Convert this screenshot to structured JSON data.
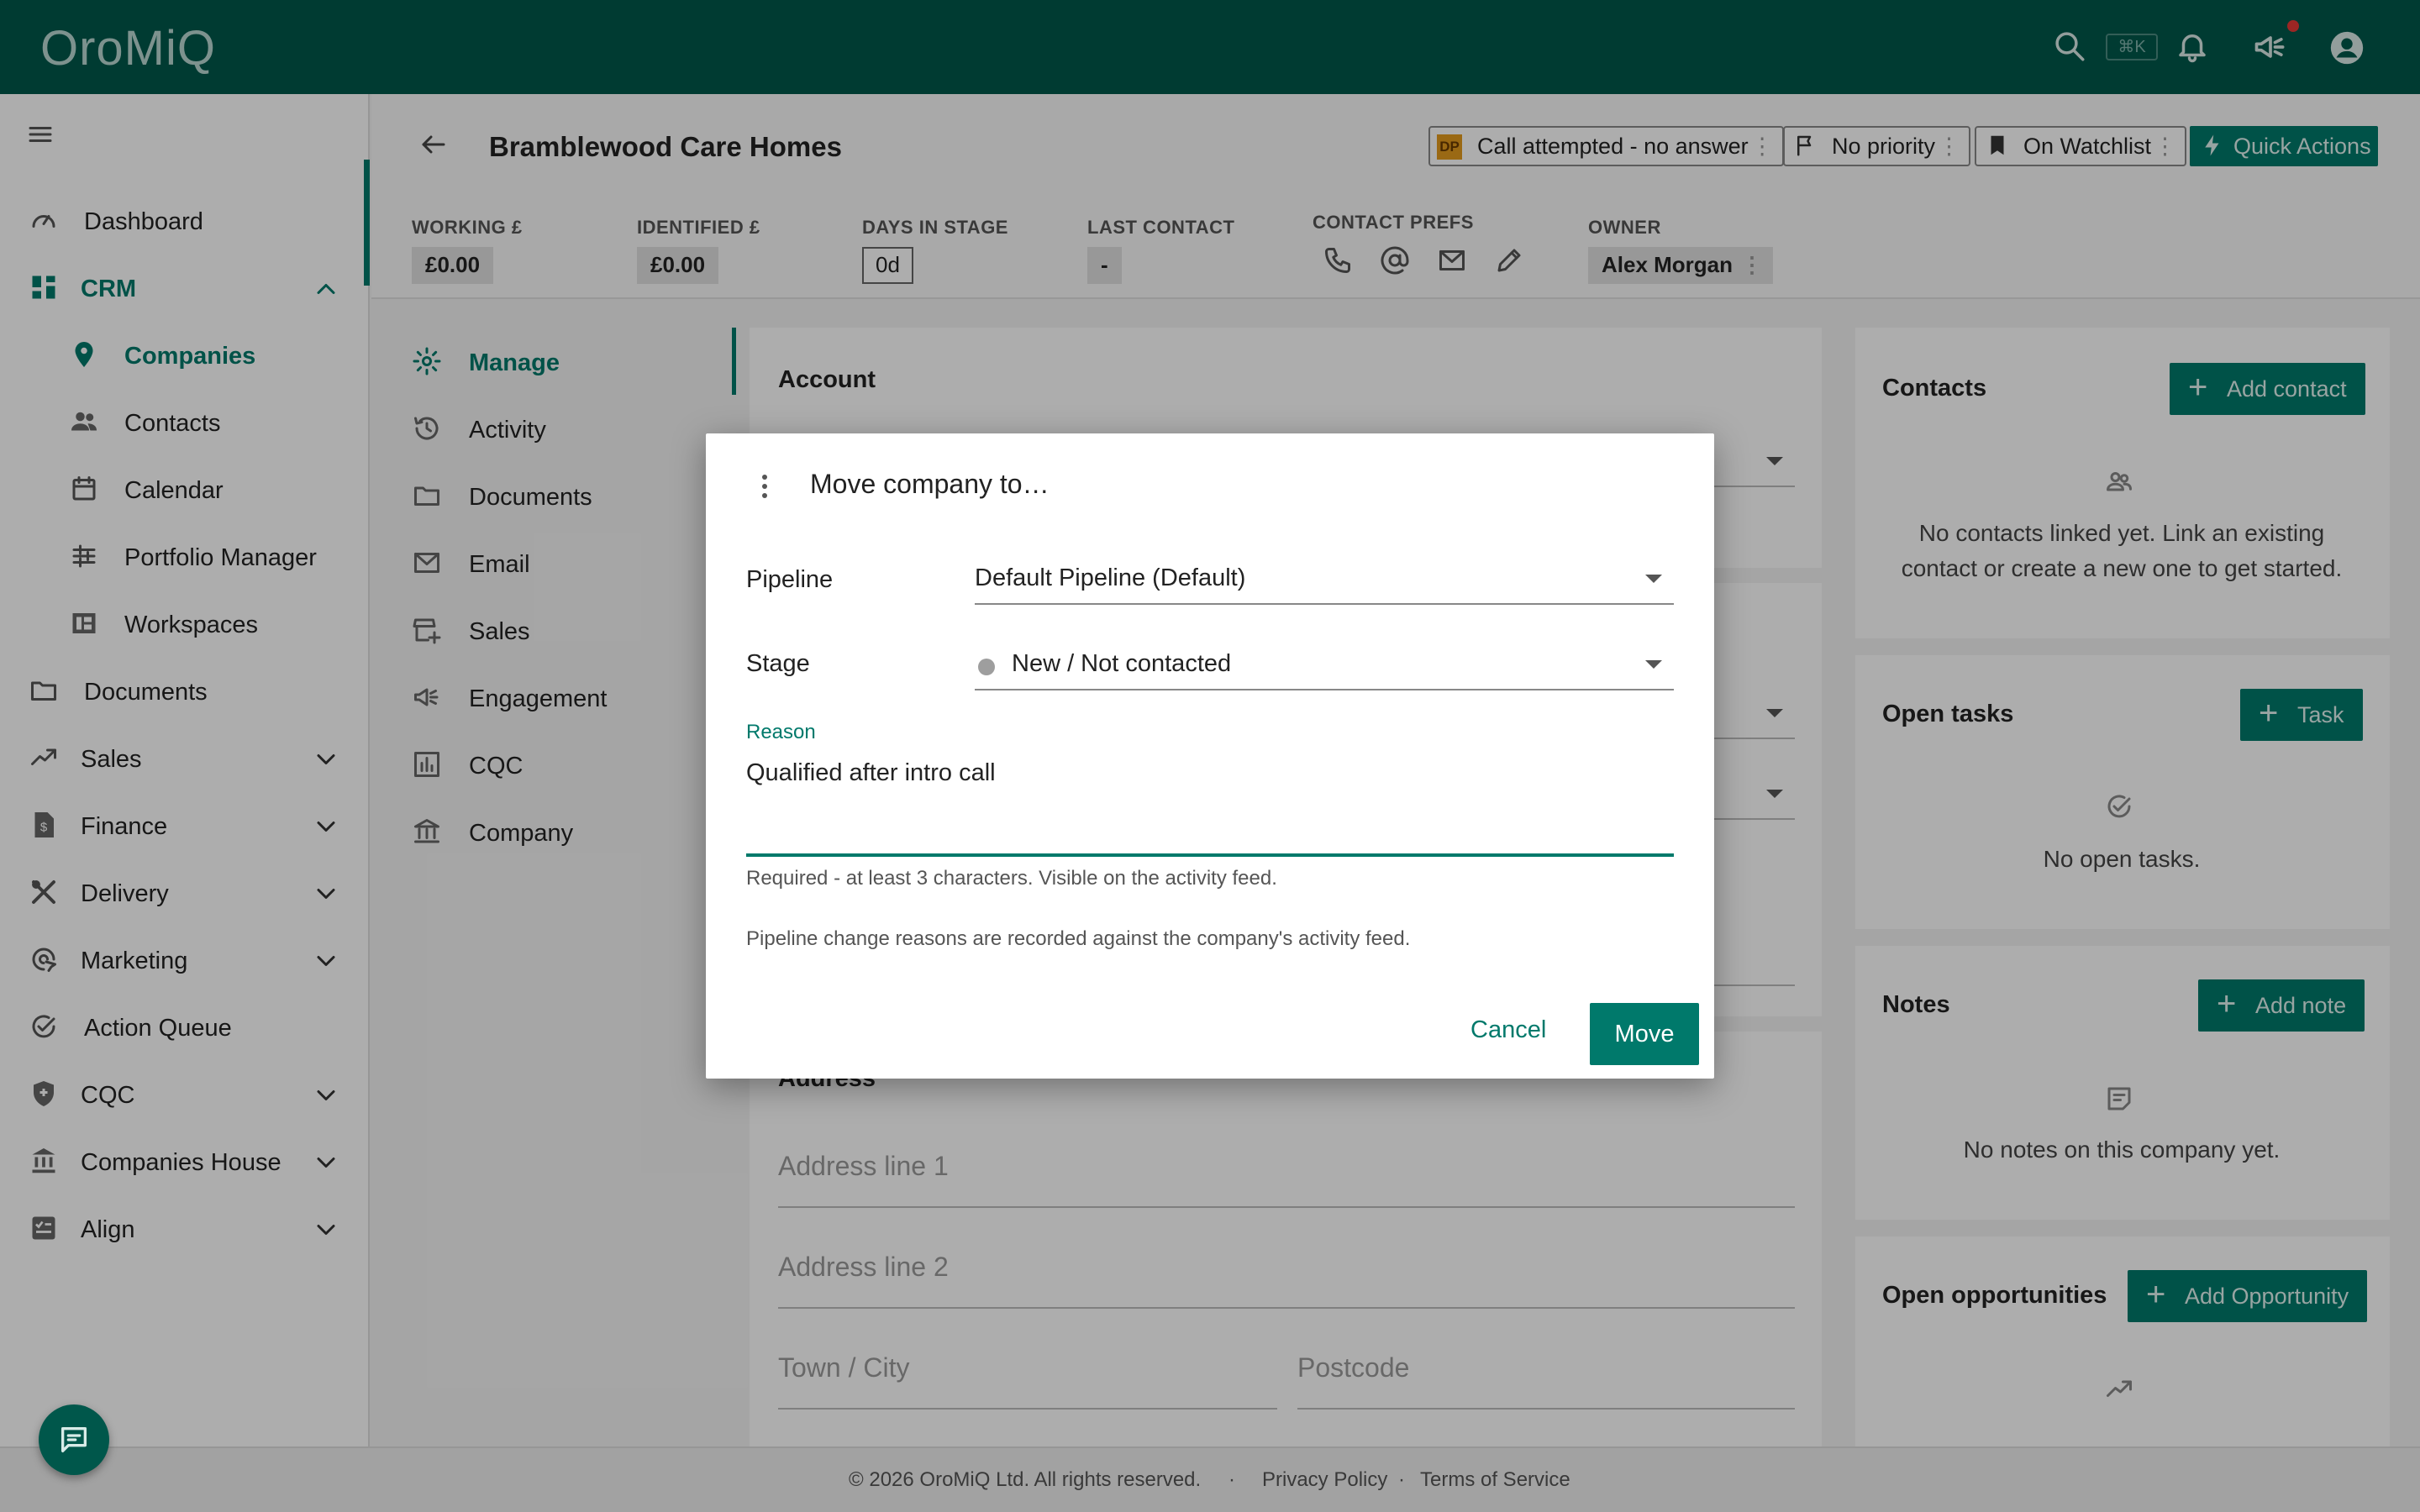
{
  "app": {
    "logo": "OroMiQ",
    "kbd_shortcut": "⌘K"
  },
  "sidebar": {
    "items": [
      {
        "label": "Dashboard"
      },
      {
        "label": "CRM"
      },
      {
        "label": "Companies"
      },
      {
        "label": "Contacts"
      },
      {
        "label": "Calendar"
      },
      {
        "label": "Portfolio Manager"
      },
      {
        "label": "Workspaces"
      },
      {
        "label": "Documents"
      },
      {
        "label": "Sales"
      },
      {
        "label": "Finance"
      },
      {
        "label": "Delivery"
      },
      {
        "label": "Marketing"
      },
      {
        "label": "Action Queue"
      },
      {
        "label": "CQC"
      },
      {
        "label": "Companies House"
      },
      {
        "label": "Align"
      }
    ]
  },
  "header": {
    "title": "Bramblewood Care Homes",
    "status_chip": {
      "badge": "DP",
      "label": "Call attempted - no answer"
    },
    "priority_chip": "No priority",
    "watchlist_chip": "On Watchlist",
    "quick_actions": "Quick Actions",
    "stats": {
      "working_label": "WORKING £",
      "working_value": "£0.00",
      "identified_label": "IDENTIFIED £",
      "identified_value": "£0.00",
      "days_label": "DAYS IN STAGE",
      "days_value": "0d",
      "last_contact_label": "LAST CONTACT",
      "last_contact_value": "-",
      "contact_prefs_label": "CONTACT PREFS",
      "owner_label": "OWNER",
      "owner_value": "Alex Morgan"
    }
  },
  "inner_nav": [
    {
      "label": "Manage"
    },
    {
      "label": "Activity"
    },
    {
      "label": "Documents"
    },
    {
      "label": "Email"
    },
    {
      "label": "Sales"
    },
    {
      "label": "Engagement"
    },
    {
      "label": "CQC"
    },
    {
      "label": "Company"
    }
  ],
  "main": {
    "account_title": "Account",
    "address_title": "Address",
    "address_line1": "Address line 1",
    "address_line2": "Address line 2",
    "town": "Town / City",
    "postcode": "Postcode"
  },
  "right": {
    "contacts": {
      "title": "Contacts",
      "button": "Add contact",
      "empty": "No contacts linked yet. Link an existing contact or create a new one to get started."
    },
    "tasks": {
      "title": "Open tasks",
      "button": "Task",
      "empty": "No open tasks."
    },
    "notes": {
      "title": "Notes",
      "button": "Add note",
      "empty": "No notes on this company yet."
    },
    "opportunities": {
      "title": "Open opportunities",
      "button": "Add Opportunity"
    }
  },
  "modal": {
    "title": "Move company to…",
    "pipeline_label": "Pipeline",
    "pipeline_value": "Default Pipeline (Default)",
    "stage_label": "Stage",
    "stage_value": "New / Not contacted",
    "reason_label": "Reason",
    "reason_value": "Qualified after intro call",
    "hint": "Required - at least 3 characters. Visible on the activity feed.",
    "note": "Pipeline change reasons are recorded against the company's activity feed.",
    "cancel": "Cancel",
    "move": "Move"
  },
  "footer": {
    "copyright": "© 2026 OroMiQ Ltd. All rights reserved.",
    "sep1": "·",
    "privacy": "Privacy Policy",
    "sep2": "·",
    "terms": "Terms of Service"
  },
  "colors": {
    "brand_dark": "#00574b",
    "accent": "#00796b",
    "status_badge": "#e39b1e",
    "notification": "#e53935"
  }
}
